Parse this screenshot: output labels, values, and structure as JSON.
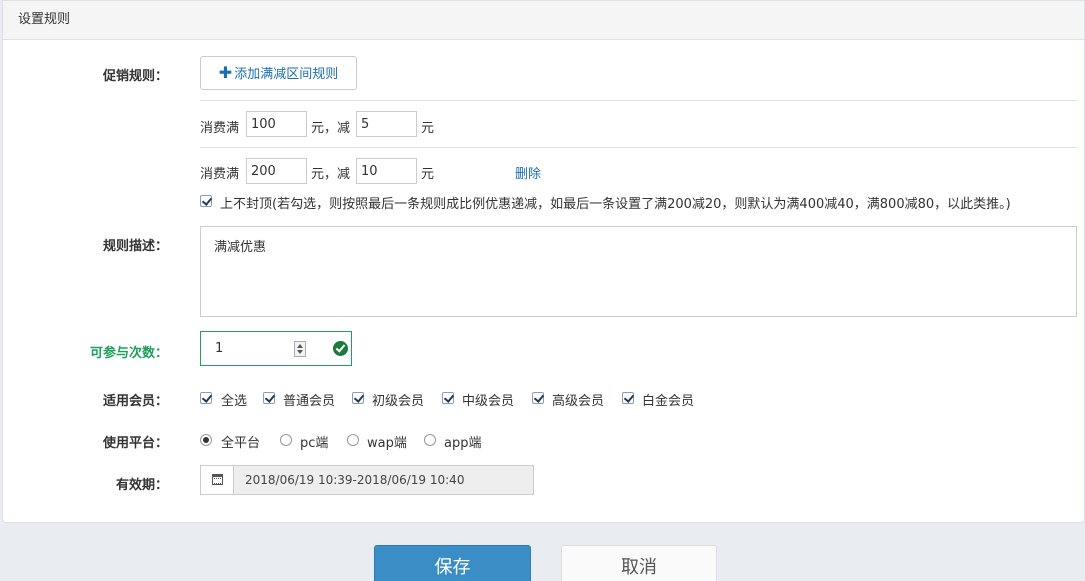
{
  "panel": {
    "title": "设置规则"
  },
  "promo": {
    "label": "促销规则：",
    "add_button": "添加满减区间规则",
    "rules": [
      {
        "prefix": "消费满",
        "threshold": "100",
        "mid": "元，减",
        "discount": "5",
        "suffix": "元"
      },
      {
        "prefix": "消费满",
        "threshold": "200",
        "mid": "元，减",
        "discount": "10",
        "suffix": "元",
        "delete_label": "删除"
      }
    ],
    "no_cap_label": "上不封顶(若勾选，则按照最后一条规则成比例优惠递减，如最后一条设置了满200减20，则默认为满400减40，满800减80，以此类推。)",
    "no_cap_checked": true
  },
  "description": {
    "label": "规则描述：",
    "value": "满减优惠"
  },
  "participation": {
    "label": "可参与次数：",
    "value": "1"
  },
  "members": {
    "label": "适用会员：",
    "options": [
      "全选",
      "普通会员",
      "初级会员",
      "中级会员",
      "高级会员",
      "白金会员"
    ],
    "checked": [
      true,
      true,
      true,
      true,
      true,
      true
    ]
  },
  "platform": {
    "label": "使用平台：",
    "options": [
      "全平台",
      "pc端",
      "wap端",
      "app端"
    ],
    "selected": "全平台"
  },
  "validity": {
    "label": "有效期：",
    "value": "2018/06/19 10:39-2018/06/19 10:40"
  },
  "actions": {
    "save": "保存",
    "cancel": "取消"
  },
  "colors": {
    "accent": "#3a8ec5",
    "link": "#1a6fae",
    "valid": "#1f9f5b"
  },
  "icons": {
    "add": "plus-icon",
    "ok": "check-circle-icon",
    "date": "calendar-icon"
  }
}
